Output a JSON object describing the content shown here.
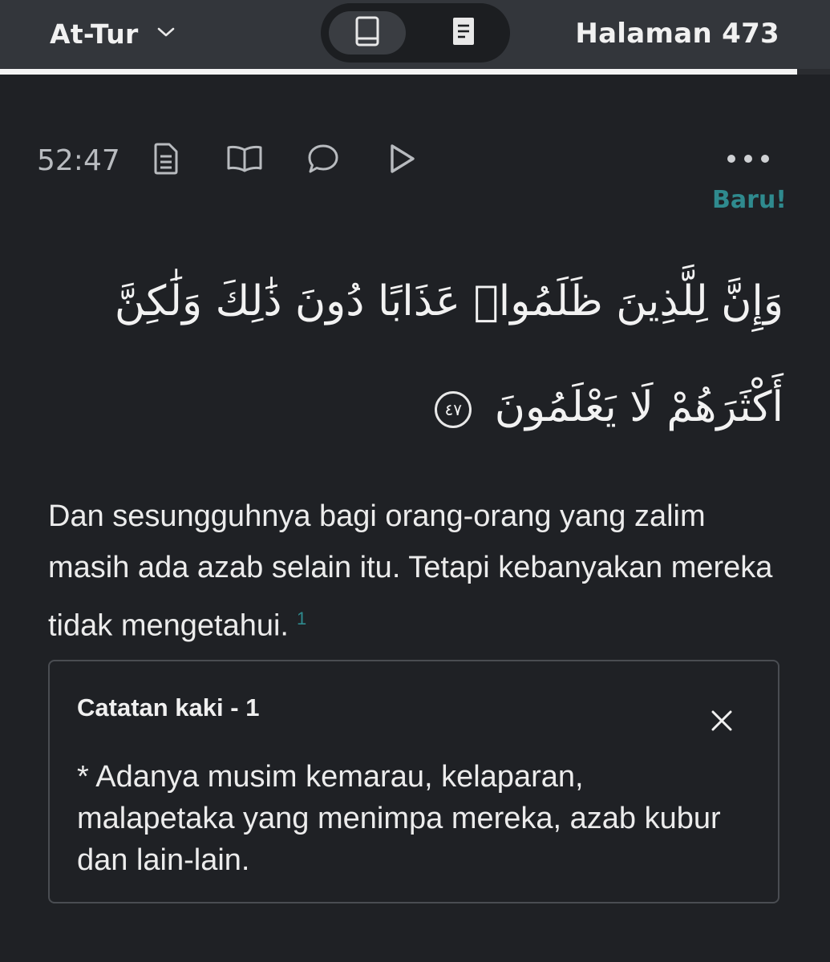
{
  "header": {
    "surah_name": "At-Tur",
    "page_label": "Halaman 473",
    "reading_progress_fraction": 0.96
  },
  "view_modes": [
    {
      "icon": "book-icon",
      "active": true
    },
    {
      "icon": "document-icon",
      "active": false
    }
  ],
  "verse": {
    "key": "52:47",
    "new_badge": "Baru!",
    "arabic_text": "وَإِنَّ لِلَّذِينَ ظَلَمُوا۟ عَذَابًا دُونَ ذَٰلِكَ وَلَٰكِنَّ أَكْثَرَهُمْ لَا يَعْلَمُونَ",
    "ayah_number": "٤٧",
    "translation": "Dan sesungguhnya bagi orang-orang yang zalim masih ada azab selain itu. Tetapi kebanyakan mereka tidak mengetahui.",
    "footnote_ref": "1"
  },
  "actions": [
    "tafsir-icon",
    "open-book-icon",
    "comment-icon",
    "play-icon",
    "more-icon"
  ],
  "footnote": {
    "title": "Catatan kaki - 1",
    "text": "* Adanya musim kemarau, kelaparan, malapetaka yang menimpa mereka, azab kubur dan lain-lain."
  },
  "colors": {
    "background": "#1f2125",
    "topbar": "#33363b",
    "accent": "#2f8a8e"
  }
}
